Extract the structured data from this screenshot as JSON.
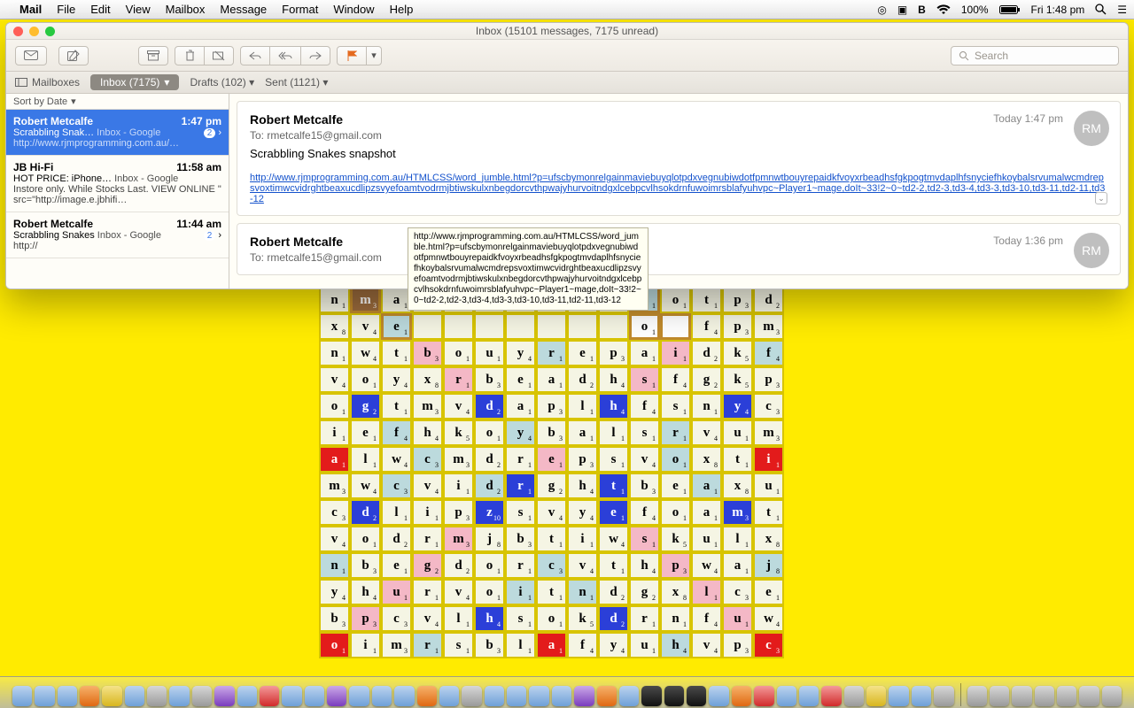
{
  "menubar": {
    "app": "Mail",
    "items": [
      "File",
      "Edit",
      "View",
      "Mailbox",
      "Message",
      "Format",
      "Window",
      "Help"
    ],
    "battery": "100%",
    "clock": "Fri 1:48 pm"
  },
  "window": {
    "title": "Inbox (15101 messages, 7175 unread)",
    "search_placeholder": "Search"
  },
  "favbar": {
    "mailboxes_label": "Mailboxes",
    "inbox_label": "Inbox (7175)",
    "drafts_label": "Drafts (102)",
    "sent_label": "Sent (1121)"
  },
  "msglist": {
    "sort_label": "Sort by Date",
    "msgs": [
      {
        "from": "Robert Metcalfe",
        "time": "1:47 pm",
        "sub": "Scrabbling Snak…",
        "src": "Inbox - Google",
        "badge": "2",
        "preview": "http://www.rjmprogramming.com.au/…",
        "sel": true
      },
      {
        "from": "JB Hi-Fi",
        "time": "11:58 am",
        "sub": "HOT PRICE: iPhone…",
        "src": "Inbox - Google",
        "badge": "",
        "preview": "Instore only. While Stocks Last. VIEW ONLINE \" src=\"http://image.e.jbhifi…",
        "sel": false
      },
      {
        "from": "Robert Metcalfe",
        "time": "11:44 am",
        "sub": "Scrabbling Snakes",
        "src": "Inbox - Google",
        "badge": "2",
        "preview": "http://",
        "sel": false
      }
    ]
  },
  "reader": {
    "msgs": [
      {
        "from": "Robert Metcalfe",
        "to": "To:   rmetcalfe15@gmail.com",
        "subj": "Scrabbling Snakes snapshot",
        "time": "Today 1:47 pm",
        "initials": "RM",
        "link": "http://www.rjmprogramming.com.au/HTMLCSS/word_jumble.html?p=ufscbymonrelgainmaviebuyqlotpdxvegnubiwdotfpmnwtbouyrepaidkfvoyxrbeadhsfgkpogtmvdaplhfsnyciefhkoybalsrvumalwcmdrepsvoxtimwcvidrghtbeaxucdlipzsvyefoamtvodrmjbtiwskulxnbegdorcvthpwajyhurvoitndgxlcebpcvlhsokdrnfuwoimrsblafyuhvpc~Player1~mage,doIt~33!2~0~td2-2,td2-3,td3-4,td3-3,td3-10,td3-11,td2-11,td3-12"
      },
      {
        "from": "Robert Metcalfe",
        "to": "To:   rmetcalfe15@gmail.com",
        "subj": "",
        "time": "Today 1:36 pm",
        "initials": "RM",
        "link": ""
      }
    ]
  },
  "tooltip": "http://www.rjmprogramming.com.au/HTMLCSS/word_jumble.html?p=ufscbymonrelgainmaviebuyqlotpdxvegnubiwdotfpmnwtbouyrepaidkfvoyxrbeadhsfgkpogtmvdaplhfsnyciefhkoybalsrvumalwcmdrepsvoxtimwcvidrghtbeaxucdlipzsvyefoamtvodrmjbtiwskulxnbegdorcvthpwajyhurvoitndgxlcebpcvlhsokdrnfuwoimrsblafyuhvpc~Player1~mage,doIt~33!2~0~td2-2,td2-3,td3-4,td3-3,td3-10,td3-11,td2-11,td3-12",
  "grid": [
    [
      [
        "n",
        1,
        ""
      ],
      [
        "m",
        3,
        "br hi"
      ],
      [
        "a",
        1,
        ""
      ],
      [
        "",
        0,
        ""
      ],
      [
        "",
        0,
        ""
      ],
      [
        "",
        0,
        ""
      ],
      [
        "",
        0,
        ""
      ],
      [
        "",
        0,
        ""
      ],
      [
        "",
        0,
        ""
      ],
      [
        "",
        0,
        ""
      ],
      [
        "l",
        1,
        "bl hi"
      ],
      [
        "o",
        1,
        ""
      ],
      [
        "t",
        1,
        ""
      ],
      [
        "p",
        3,
        ""
      ],
      [
        "d",
        2,
        ""
      ]
    ],
    [
      [
        "x",
        8,
        ""
      ],
      [
        "v",
        4,
        ""
      ],
      [
        "e",
        1,
        "bl hi"
      ],
      [
        "",
        0,
        ""
      ],
      [
        "",
        0,
        ""
      ],
      [
        "",
        0,
        ""
      ],
      [
        "",
        0,
        ""
      ],
      [
        "",
        0,
        ""
      ],
      [
        "",
        0,
        ""
      ],
      [
        "",
        0,
        ""
      ],
      [
        "o",
        1,
        "hi wh"
      ],
      [
        "",
        0,
        "br hi wh"
      ],
      [
        "f",
        4,
        ""
      ],
      [
        "p",
        3,
        ""
      ],
      [
        "m",
        3,
        ""
      ]
    ],
    [
      [
        "n",
        1,
        ""
      ],
      [
        "w",
        4,
        ""
      ],
      [
        "t",
        1,
        ""
      ],
      [
        "b",
        3,
        "pk"
      ],
      [
        "o",
        1,
        ""
      ],
      [
        "u",
        1,
        ""
      ],
      [
        "y",
        4,
        ""
      ],
      [
        "r",
        1,
        "bl"
      ],
      [
        "e",
        1,
        ""
      ],
      [
        "p",
        3,
        ""
      ],
      [
        "a",
        1,
        ""
      ],
      [
        "i",
        1,
        "pk"
      ],
      [
        "d",
        2,
        ""
      ],
      [
        "k",
        5,
        ""
      ],
      [
        "f",
        4,
        "bl"
      ]
    ],
    [
      [
        "v",
        4,
        ""
      ],
      [
        "o",
        1,
        ""
      ],
      [
        "y",
        4,
        ""
      ],
      [
        "x",
        8,
        ""
      ],
      [
        "r",
        1,
        "pk"
      ],
      [
        "b",
        3,
        ""
      ],
      [
        "e",
        1,
        ""
      ],
      [
        "a",
        1,
        ""
      ],
      [
        "d",
        2,
        ""
      ],
      [
        "h",
        4,
        ""
      ],
      [
        "s",
        1,
        "pk"
      ],
      [
        "f",
        4,
        ""
      ],
      [
        "g",
        2,
        ""
      ],
      [
        "k",
        5,
        ""
      ],
      [
        "p",
        3,
        ""
      ]
    ],
    [
      [
        "o",
        1,
        ""
      ],
      [
        "g",
        2,
        "bu"
      ],
      [
        "t",
        1,
        ""
      ],
      [
        "m",
        3,
        ""
      ],
      [
        "v",
        4,
        ""
      ],
      [
        "d",
        2,
        "bu"
      ],
      [
        "a",
        1,
        ""
      ],
      [
        "p",
        3,
        ""
      ],
      [
        "l",
        1,
        ""
      ],
      [
        "h",
        4,
        "bu"
      ],
      [
        "f",
        4,
        ""
      ],
      [
        "s",
        1,
        ""
      ],
      [
        "n",
        1,
        ""
      ],
      [
        "y",
        4,
        "bu"
      ],
      [
        "c",
        3,
        ""
      ]
    ],
    [
      [
        "i",
        1,
        ""
      ],
      [
        "e",
        1,
        ""
      ],
      [
        "f",
        4,
        "bl"
      ],
      [
        "h",
        4,
        ""
      ],
      [
        "k",
        5,
        ""
      ],
      [
        "o",
        1,
        ""
      ],
      [
        "y",
        4,
        "bl"
      ],
      [
        "b",
        3,
        ""
      ],
      [
        "a",
        1,
        ""
      ],
      [
        "l",
        1,
        ""
      ],
      [
        "s",
        1,
        ""
      ],
      [
        "r",
        1,
        "bl"
      ],
      [
        "v",
        4,
        ""
      ],
      [
        "u",
        1,
        ""
      ],
      [
        "m",
        3,
        ""
      ]
    ],
    [
      [
        "a",
        1,
        "rd"
      ],
      [
        "l",
        1,
        ""
      ],
      [
        "w",
        4,
        ""
      ],
      [
        "c",
        3,
        "bl"
      ],
      [
        "m",
        3,
        ""
      ],
      [
        "d",
        2,
        ""
      ],
      [
        "r",
        1,
        ""
      ],
      [
        "e",
        1,
        "pk"
      ],
      [
        "p",
        3,
        ""
      ],
      [
        "s",
        1,
        ""
      ],
      [
        "v",
        4,
        ""
      ],
      [
        "o",
        1,
        "bl"
      ],
      [
        "x",
        8,
        ""
      ],
      [
        "t",
        1,
        ""
      ],
      [
        "i",
        1,
        "rd"
      ]
    ],
    [
      [
        "m",
        3,
        ""
      ],
      [
        "w",
        4,
        ""
      ],
      [
        "c",
        3,
        "bl"
      ],
      [
        "v",
        4,
        ""
      ],
      [
        "i",
        1,
        ""
      ],
      [
        "d",
        2,
        "bl"
      ],
      [
        "r",
        1,
        "bu"
      ],
      [
        "g",
        2,
        ""
      ],
      [
        "h",
        4,
        ""
      ],
      [
        "t",
        1,
        "bu"
      ],
      [
        "b",
        3,
        ""
      ],
      [
        "e",
        1,
        ""
      ],
      [
        "a",
        1,
        "bl"
      ],
      [
        "x",
        8,
        ""
      ],
      [
        "u",
        1,
        ""
      ]
    ],
    [
      [
        "c",
        3,
        ""
      ],
      [
        "d",
        2,
        "bu"
      ],
      [
        "l",
        1,
        ""
      ],
      [
        "i",
        1,
        ""
      ],
      [
        "p",
        3,
        ""
      ],
      [
        "z",
        10,
        "bu"
      ],
      [
        "s",
        1,
        ""
      ],
      [
        "v",
        4,
        ""
      ],
      [
        "y",
        4,
        ""
      ],
      [
        "e",
        1,
        "bu"
      ],
      [
        "f",
        4,
        ""
      ],
      [
        "o",
        1,
        ""
      ],
      [
        "a",
        1,
        ""
      ],
      [
        "m",
        3,
        "bu"
      ],
      [
        "t",
        1,
        ""
      ]
    ],
    [
      [
        "v",
        4,
        ""
      ],
      [
        "o",
        1,
        ""
      ],
      [
        "d",
        2,
        ""
      ],
      [
        "r",
        1,
        ""
      ],
      [
        "m",
        3,
        "pk"
      ],
      [
        "j",
        8,
        ""
      ],
      [
        "b",
        3,
        ""
      ],
      [
        "t",
        1,
        ""
      ],
      [
        "i",
        1,
        ""
      ],
      [
        "w",
        4,
        ""
      ],
      [
        "s",
        1,
        "pk"
      ],
      [
        "k",
        5,
        ""
      ],
      [
        "u",
        1,
        ""
      ],
      [
        "l",
        1,
        ""
      ],
      [
        "x",
        8,
        ""
      ]
    ],
    [
      [
        "n",
        1,
        "bl"
      ],
      [
        "b",
        3,
        ""
      ],
      [
        "e",
        1,
        ""
      ],
      [
        "g",
        2,
        "pk"
      ],
      [
        "d",
        2,
        ""
      ],
      [
        "o",
        1,
        ""
      ],
      [
        "r",
        1,
        ""
      ],
      [
        "c",
        3,
        "bl"
      ],
      [
        "v",
        4,
        ""
      ],
      [
        "t",
        1,
        ""
      ],
      [
        "h",
        4,
        ""
      ],
      [
        "p",
        3,
        "pk"
      ],
      [
        "w",
        4,
        ""
      ],
      [
        "a",
        1,
        ""
      ],
      [
        "j",
        8,
        "bl"
      ]
    ],
    [
      [
        "y",
        4,
        ""
      ],
      [
        "h",
        4,
        ""
      ],
      [
        "u",
        1,
        "pk"
      ],
      [
        "r",
        1,
        ""
      ],
      [
        "v",
        4,
        ""
      ],
      [
        "o",
        1,
        ""
      ],
      [
        "i",
        1,
        "bl"
      ],
      [
        "t",
        1,
        ""
      ],
      [
        "n",
        1,
        "bl"
      ],
      [
        "d",
        2,
        ""
      ],
      [
        "g",
        2,
        ""
      ],
      [
        "x",
        8,
        ""
      ],
      [
        "l",
        1,
        "pk"
      ],
      [
        "c",
        3,
        ""
      ],
      [
        "e",
        1,
        ""
      ]
    ],
    [
      [
        "b",
        3,
        ""
      ],
      [
        "p",
        3,
        "pk"
      ],
      [
        "c",
        3,
        ""
      ],
      [
        "v",
        4,
        ""
      ],
      [
        "l",
        1,
        ""
      ],
      [
        "h",
        4,
        "bu"
      ],
      [
        "s",
        1,
        ""
      ],
      [
        "o",
        1,
        ""
      ],
      [
        "k",
        5,
        ""
      ],
      [
        "d",
        2,
        "bu"
      ],
      [
        "r",
        1,
        ""
      ],
      [
        "n",
        1,
        ""
      ],
      [
        "f",
        4,
        ""
      ],
      [
        "u",
        1,
        "pk"
      ],
      [
        "w",
        4,
        ""
      ]
    ],
    [
      [
        "o",
        1,
        "rd"
      ],
      [
        "i",
        1,
        ""
      ],
      [
        "m",
        3,
        ""
      ],
      [
        "r",
        1,
        "bl"
      ],
      [
        "s",
        1,
        ""
      ],
      [
        "b",
        3,
        ""
      ],
      [
        "l",
        1,
        ""
      ],
      [
        "a",
        1,
        "rd"
      ],
      [
        "f",
        4,
        ""
      ],
      [
        "y",
        4,
        ""
      ],
      [
        "u",
        1,
        ""
      ],
      [
        "h",
        4,
        "bl"
      ],
      [
        "v",
        4,
        ""
      ],
      [
        "p",
        3,
        ""
      ],
      [
        "c",
        3,
        "rd"
      ]
    ]
  ]
}
